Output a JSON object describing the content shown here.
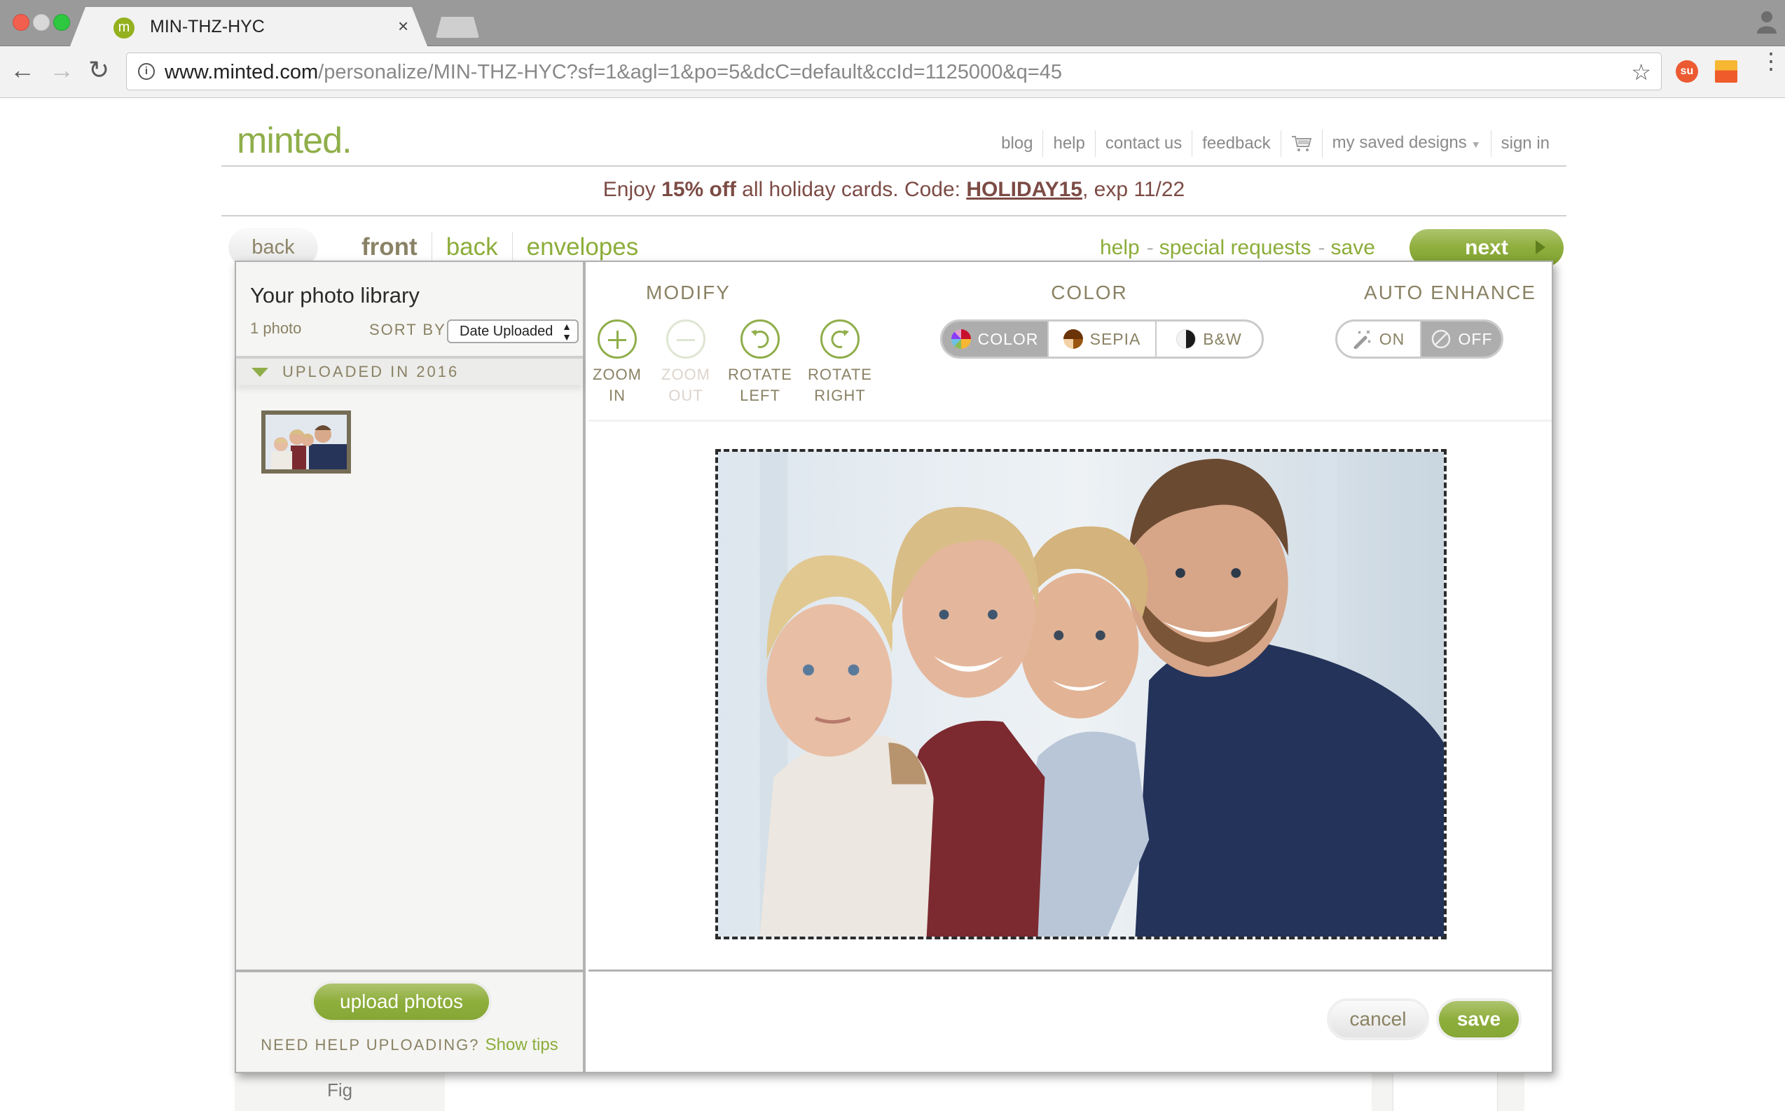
{
  "browser": {
    "tab_title": "MIN-THZ-HYC",
    "tab_favicon_letter": "m",
    "tab_close": "×",
    "url_host": "www.minted.com",
    "url_path": "/personalize/MIN-THZ-HYC?sf=1&agl=1&po=5&dcC=default&ccId=1125000&q=45",
    "icons": {
      "back": "←",
      "forward": "→",
      "reload": "↻",
      "info": "i",
      "star": "☆",
      "menu": "⋮",
      "ext1": "su"
    }
  },
  "header": {
    "logo": "minted.",
    "nav": [
      "blog",
      "help",
      "contact us",
      "feedback"
    ],
    "saved_designs": "my saved designs",
    "sign_in": "sign in"
  },
  "promo": {
    "prefix": "Enjoy ",
    "discount": "15% off",
    "middle": " all holiday cards. Code: ",
    "code": "HOLIDAY15",
    "suffix": ", exp 11/22"
  },
  "subnav": {
    "back_button": "back",
    "tabs": [
      "front",
      "back",
      "envelopes"
    ],
    "active_tab": "front",
    "links": [
      "help",
      "special requests",
      "save"
    ],
    "separator": "-",
    "next_button": "next"
  },
  "library": {
    "title": "Your photo library",
    "count": "1 photo",
    "sort_label": "SORT BY",
    "sort_value": "Date Uploaded",
    "group_label": "UPLOADED IN 2016",
    "upload_button": "upload photos",
    "help_text": "NEED HELP UPLOADING?",
    "help_link": "Show tips"
  },
  "editor": {
    "modify": {
      "title": "MODIFY",
      "tools": [
        {
          "line1": "ZOOM",
          "line2": "IN",
          "enabled": true
        },
        {
          "line1": "ZOOM",
          "line2": "OUT",
          "enabled": false
        },
        {
          "line1": "ROTATE",
          "line2": "LEFT",
          "enabled": true
        },
        {
          "line1": "ROTATE",
          "line2": "RIGHT",
          "enabled": true
        }
      ]
    },
    "color": {
      "title": "COLOR",
      "options": [
        "COLOR",
        "SEPIA",
        "B&W"
      ],
      "selected": "COLOR"
    },
    "auto_enhance": {
      "title": "AUTO ENHANCE",
      "options": [
        "ON",
        "OFF"
      ],
      "selected": "OFF"
    },
    "cancel_button": "cancel",
    "save_button": "save"
  },
  "background": {
    "fig_label": "Fig"
  },
  "colors": {
    "brand_green": "#8fae4a",
    "link_green": "#8cad3a",
    "muted_taupe": "#8a8264",
    "promo_red": "#7c4b45",
    "toggle_active": "#adadad"
  }
}
